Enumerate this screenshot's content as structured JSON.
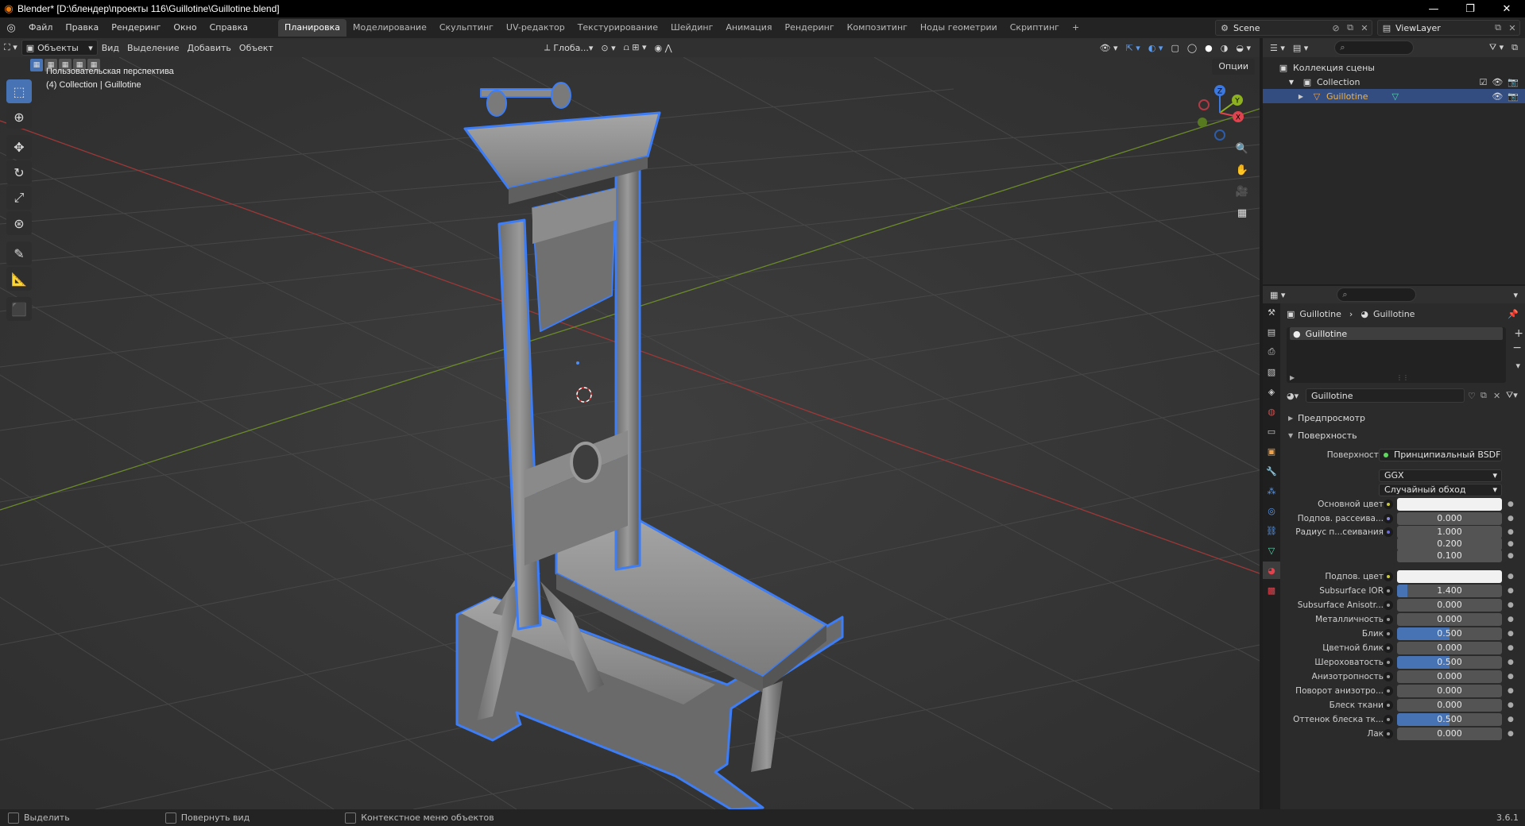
{
  "window": {
    "title": "Blender* [D:\\блендер\\проекты 116\\Guillotine\\Guillotine.blend]",
    "controls": [
      "—",
      "❐",
      "✕"
    ]
  },
  "menu": [
    "Файл",
    "Правка",
    "Рендеринг",
    "Окно",
    "Справка"
  ],
  "workspaces": [
    "Планировка",
    "Моделирование",
    "Скульптинг",
    "UV-редактор",
    "Текстурирование",
    "Шейдинг",
    "Анимация",
    "Рендеринг",
    "Композитинг",
    "Ноды геометрии",
    "Скриптинг",
    "+"
  ],
  "scene": {
    "name": "Scene",
    "view_layer": "ViewLayer"
  },
  "viewport_header": {
    "mode": "Объекты",
    "menus": [
      "Вид",
      "Выделение",
      "Добавить",
      "Объект"
    ],
    "transform": "Глоба...",
    "options": "Опции"
  },
  "viewport": {
    "perspective": "Пользовательская перспектива",
    "collection_info": "(4) Collection | Guillotine",
    "gizmo_axes": [
      "Z",
      "Y",
      "X"
    ]
  },
  "outliner": {
    "root": "Коллекция сцены",
    "collection": "Collection",
    "object": "Guillotine"
  },
  "properties": {
    "breadcrumb_object": "Guillotine",
    "breadcrumb_material": "Guillotine",
    "slot": "Guillotine",
    "material_name": "Guillotine",
    "panels": {
      "preview": "Предпросмотр",
      "surface": "Поверхность"
    },
    "surface_label": "Поверхность",
    "surface_shader": "Принципиальный BSDF",
    "distribution": "GGX",
    "subsurface_method": "Случайный обход",
    "rows": [
      {
        "label": "Основной цвет",
        "value": "",
        "type": "color",
        "dot": "#c9c93c"
      },
      {
        "label": "Подпов. рассеива...",
        "value": "0.000",
        "type": "num",
        "dot": "#8b8bd6"
      },
      {
        "label": "Радиус п...сеивания",
        "value": "1.000",
        "type": "num",
        "dot": "#6b6bd6"
      },
      {
        "label": "",
        "value": "0.200",
        "type": "num",
        "dot": ""
      },
      {
        "label": "",
        "value": "0.100",
        "type": "num",
        "dot": ""
      },
      {
        "label": "Подпов. цвет",
        "value": "",
        "type": "color",
        "dot": "#c9c93c"
      },
      {
        "label": "Subsurface IOR",
        "value": "1.400",
        "type": "num",
        "dot": "#9a9a9a",
        "fill": 0.1
      },
      {
        "label": "Subsurface Anisotr...",
        "value": "0.000",
        "type": "num",
        "dot": "#9a9a9a"
      },
      {
        "label": "Металличность",
        "value": "0.000",
        "type": "num",
        "dot": "#9a9a9a"
      },
      {
        "label": "Блик",
        "value": "0.500",
        "type": "num",
        "dot": "#9a9a9a",
        "fill": 0.5
      },
      {
        "label": "Цветной блик",
        "value": "0.000",
        "type": "num",
        "dot": "#9a9a9a"
      },
      {
        "label": "Шероховатость",
        "value": "0.500",
        "type": "num",
        "dot": "#9a9a9a",
        "fill": 0.5
      },
      {
        "label": "Анизотропность",
        "value": "0.000",
        "type": "num",
        "dot": "#9a9a9a"
      },
      {
        "label": "Поворот анизотро...",
        "value": "0.000",
        "type": "num",
        "dot": "#9a9a9a"
      },
      {
        "label": "Блеск ткани",
        "value": "0.000",
        "type": "num",
        "dot": "#9a9a9a"
      },
      {
        "label": "Оттенок блеска тк...",
        "value": "0.500",
        "type": "num",
        "dot": "#9a9a9a",
        "fill": 0.5
      },
      {
        "label": "Лак",
        "value": "0.000",
        "type": "num",
        "dot": "#9a9a9a"
      }
    ]
  },
  "statusbar": {
    "select": "Выделить",
    "rotate": "Повернуть вид",
    "context_menu": "Контекстное меню объектов",
    "version": "3.6.1"
  },
  "colors": {
    "accent": "#4772b3",
    "selection_outline": "#3d7df5",
    "active_text": "#f0b44b"
  }
}
